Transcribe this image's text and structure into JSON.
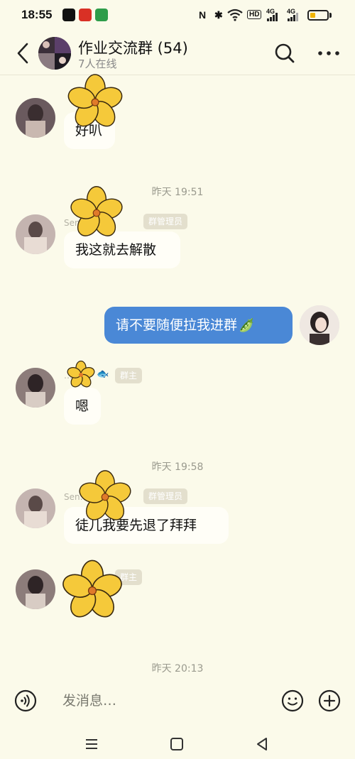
{
  "status_bar": {
    "time": "18:55",
    "network": "HD",
    "signal1": "4G",
    "signal2": "4G",
    "battery_level": 0.3
  },
  "header": {
    "title": "作业交流群 (54)",
    "subtitle": "7人在线"
  },
  "messages": [
    {
      "kind": "incoming",
      "text": "好叭"
    },
    {
      "kind": "timestamp",
      "text": "昨天 19:51"
    },
    {
      "kind": "incoming",
      "sender": "Sen…叶~",
      "badge": "群管理员",
      "text": "我这就去解散"
    },
    {
      "kind": "outgoing",
      "text": "请不要随便拉我进群",
      "emoji": "🫛"
    },
    {
      "kind": "incoming",
      "sender": "…",
      "badge": "群主",
      "text": "嗯"
    },
    {
      "kind": "timestamp",
      "text": "昨天 19:58"
    },
    {
      "kind": "incoming",
      "sender": "Sen…叶~",
      "badge": "群管理员",
      "text": "徒儿我要先退了拜拜"
    },
    {
      "kind": "incoming",
      "sender": "",
      "badge": "群主",
      "text": ""
    },
    {
      "kind": "timestamp",
      "text": "昨天 20:13"
    }
  ],
  "composer": {
    "placeholder": "发消息…"
  },
  "colors": {
    "background": "#fbfaea",
    "outgoing_bubble": "#4a88d6",
    "incoming_bubble": "#fffef7",
    "badge": "#e3dfcd",
    "flower": "#f5c93a"
  },
  "icons": {
    "back": "chevron-left-icon",
    "search": "search-icon",
    "more": "more-dots-icon",
    "voice": "voice-icon",
    "emoji": "emoji-icon",
    "plus": "plus-icon",
    "sticker": "flower-sticker-icon"
  }
}
